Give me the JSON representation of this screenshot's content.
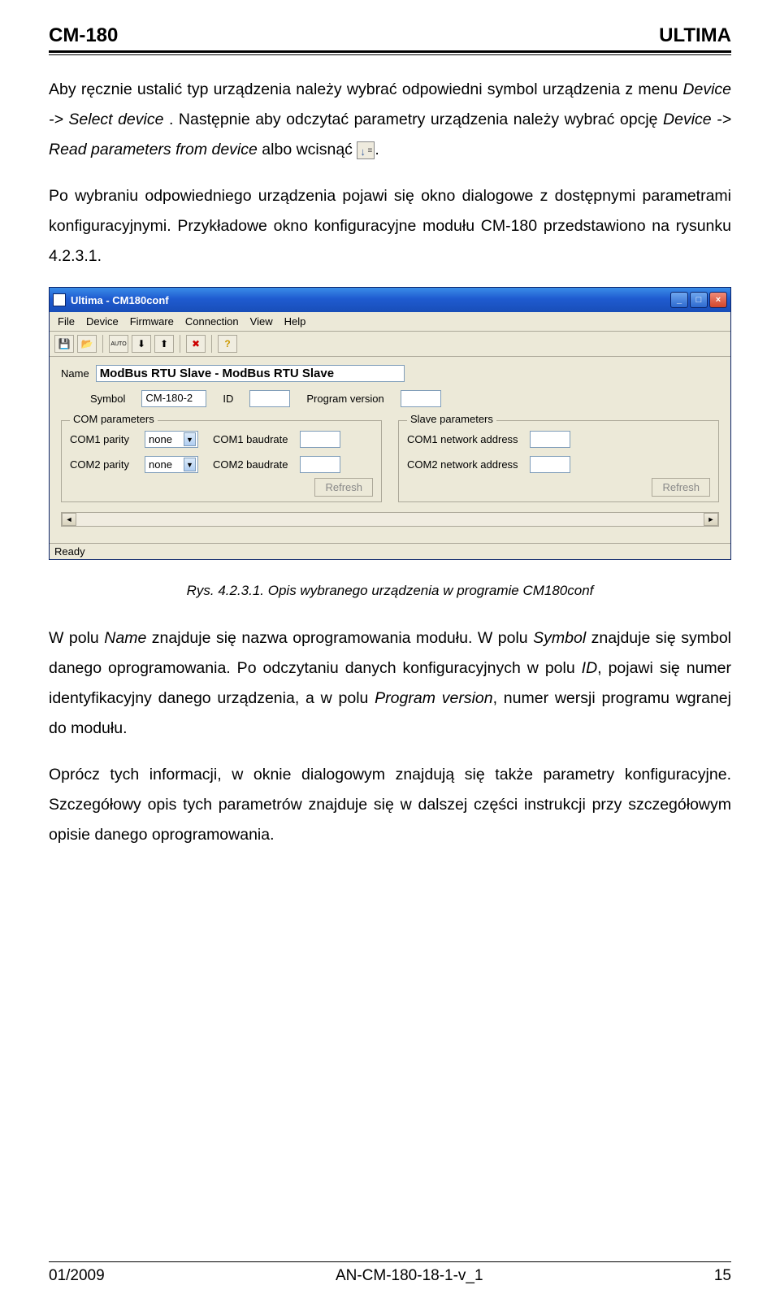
{
  "header": {
    "left": "CM-180",
    "right": "ULTIMA"
  },
  "para1_a": "Aby ręcznie ustalić typ urządzenia należy wybrać odpowiedni symbol urządzenia z menu ",
  "para1_b": "Device -> Select device",
  "para1_c": ". Następnie aby odczytać parametry urządzenia należy wybrać opcję ",
  "para1_d": "Device -> Read parameters from device",
  "para1_e": " albo wcisnąć ",
  "para1_f": ".",
  "para2": "Po wybraniu odpowiedniego urządzenia pojawi się okno dialogowe z dostępnymi parametrami konfiguracyjnymi. Przykładowe okno konfiguracyjne modułu CM-180 przedstawiono  na rysunku  4.2.3.1.",
  "window": {
    "title": "Ultima - CM180conf",
    "menus": [
      "File",
      "Device",
      "Firmware",
      "Connection",
      "View",
      "Help"
    ],
    "labels": {
      "name": "Name",
      "symbol": "Symbol",
      "id": "ID",
      "progver": "Program version",
      "com_group": "COM parameters",
      "slave_group": "Slave parameters",
      "com1_parity": "COM1 parity",
      "com2_parity": "COM2 parity",
      "com1_baud": "COM1 baudrate",
      "com2_baud": "COM2 baudrate",
      "com1_net": "COM1 network address",
      "com2_net": "COM2 network address",
      "refresh": "Refresh",
      "ready": "Ready"
    },
    "values": {
      "name": "ModBus RTU Slave - ModBus RTU Slave",
      "symbol": "CM-180-2",
      "parity": "none"
    }
  },
  "caption": "Rys. 4.2.3.1. Opis wybranego urządzenia w programie CM180conf",
  "para3_a": "W polu ",
  "para3_b": "Name",
  "para3_c": " znajduje się nazwa oprogramowania modułu. W polu ",
  "para3_d": "Symbol",
  "para3_e": " znajduje się symbol danego oprogramowania. Po odczytaniu danych konfiguracyjnych w polu ",
  "para3_f": "ID",
  "para3_g": ", pojawi się numer identyfikacyjny danego urządzenia, a w polu ",
  "para3_h": "Program version",
  "para3_i": ", numer wersji programu wgranej do modułu.",
  "para4": "Oprócz tych informacji, w oknie dialogowym znajdują się także parametry konfiguracyjne. Szczegółowy opis tych parametrów znajduje się w dalszej części instrukcji przy szczegółowym opisie danego oprogramowania.",
  "footer": {
    "left": "01/2009",
    "center": "AN-CM-180-18-1-v_1",
    "right": "15"
  }
}
